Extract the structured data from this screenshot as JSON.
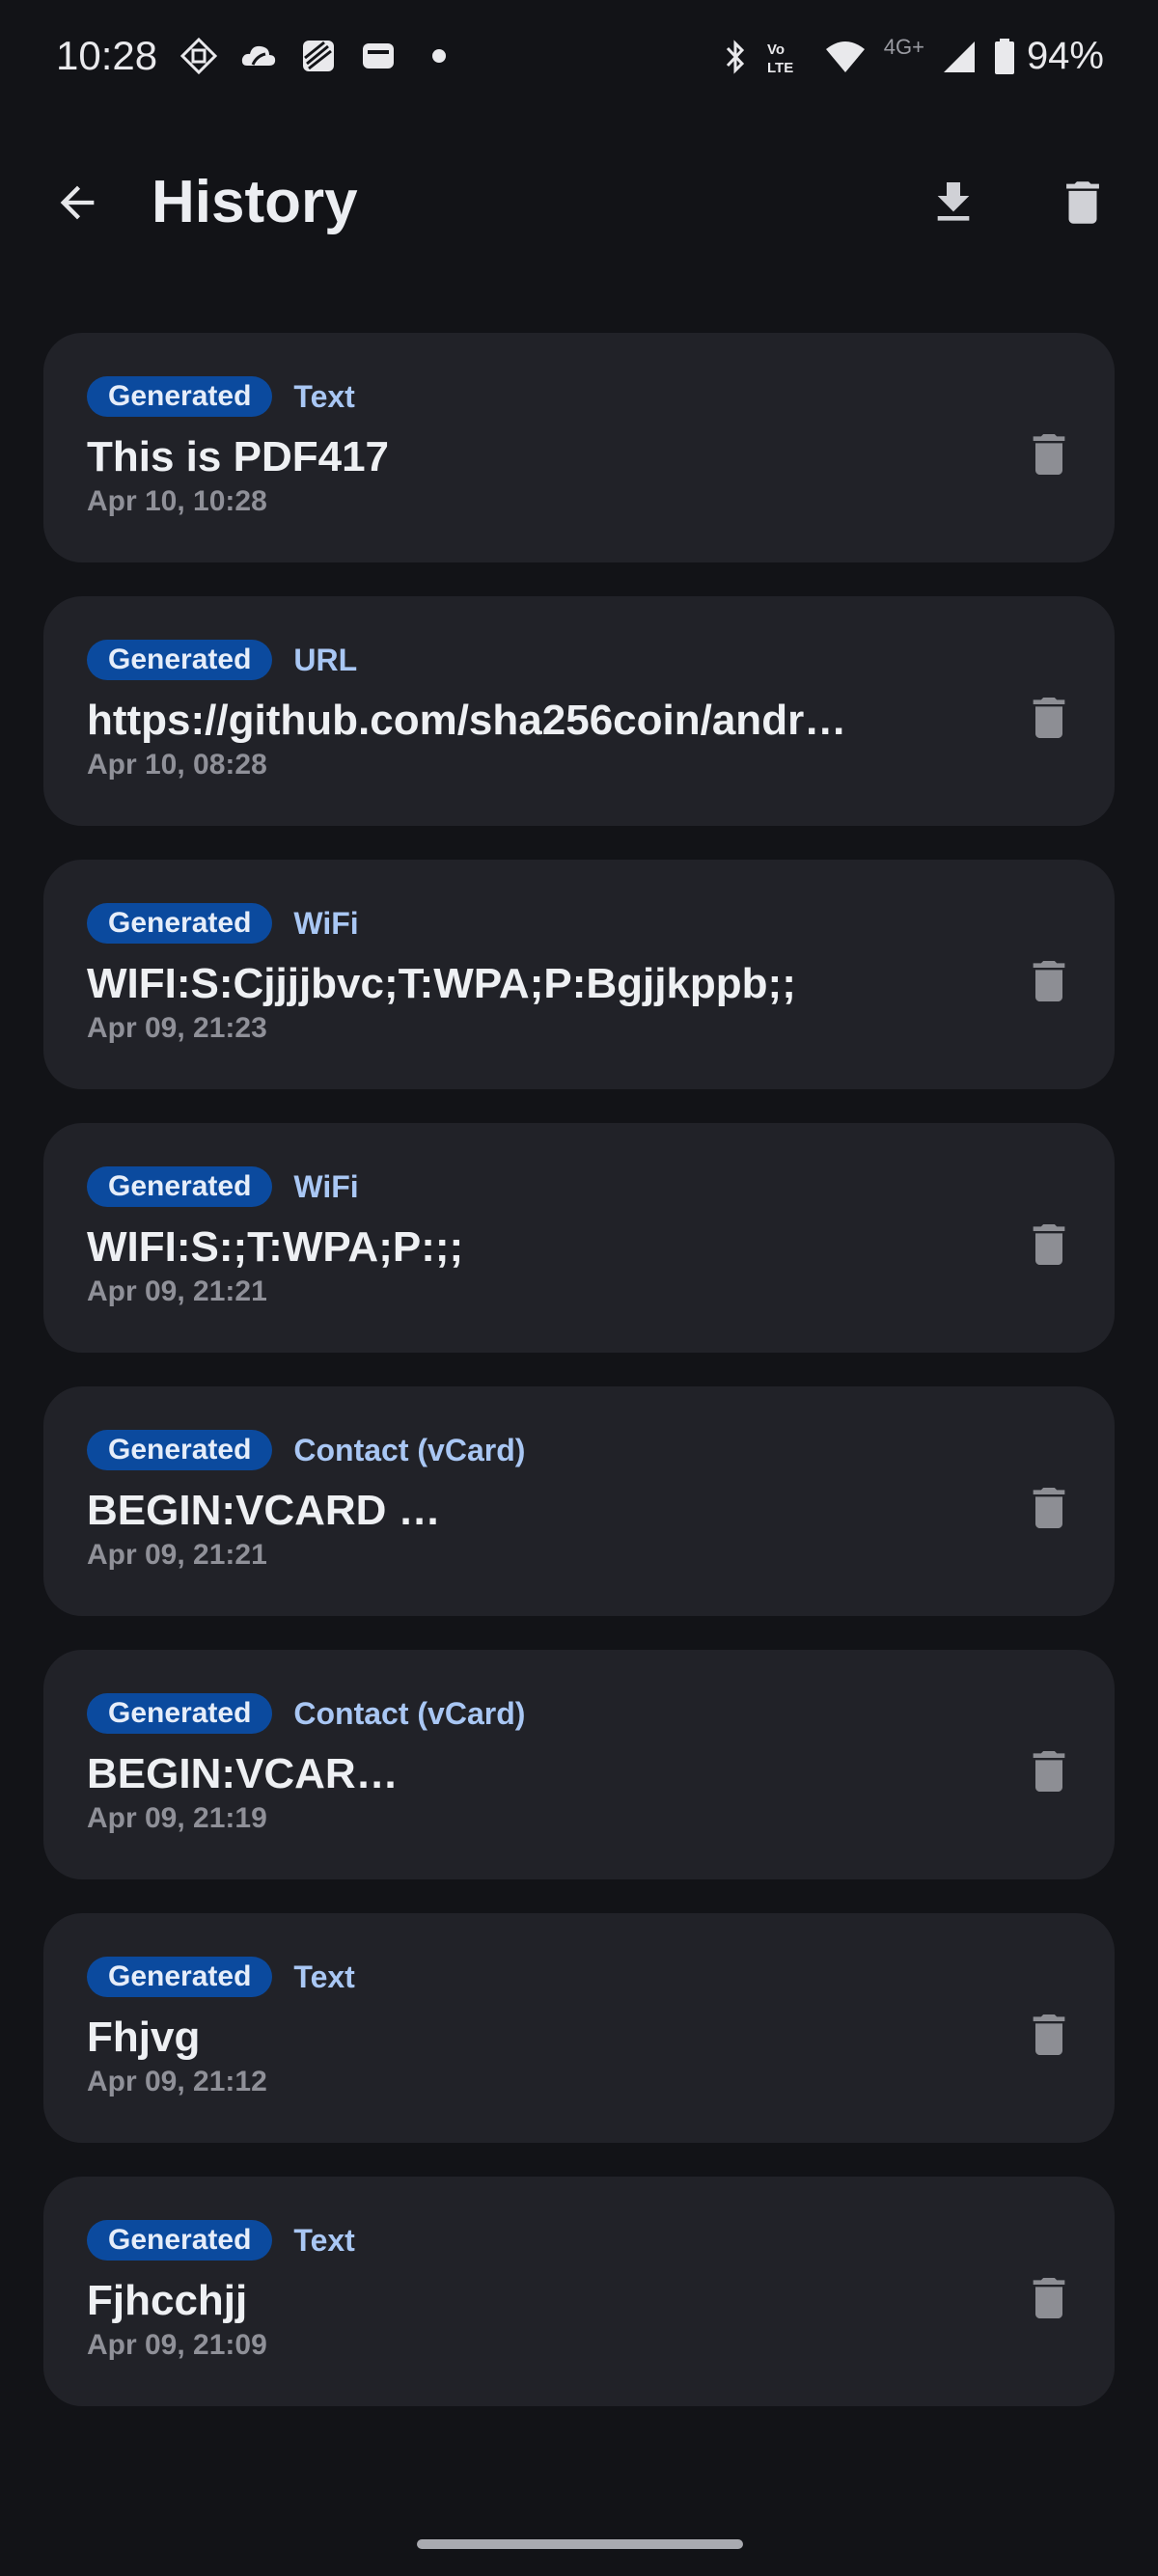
{
  "status_bar": {
    "time": "10:28",
    "network_label": "4G+",
    "battery": "94%"
  },
  "header": {
    "title": "History",
    "back_icon": "arrow-left-icon",
    "download_icon": "download-icon",
    "delete_all_icon": "trash-icon"
  },
  "items": [
    {
      "badge": "Generated",
      "type": "Text",
      "content": "This is PDF417",
      "time": "Apr 10, 10:28"
    },
    {
      "badge": "Generated",
      "type": "URL",
      "content": "https://github.com/sha256coin/andr…",
      "time": "Apr 10, 08:28"
    },
    {
      "badge": "Generated",
      "type": "WiFi",
      "content": "WIFI:S:Cjjjjbvc;T:WPA;P:Bgjjkppb;;",
      "time": "Apr 09, 21:23"
    },
    {
      "badge": "Generated",
      "type": "WiFi",
      "content": "WIFI:S:;T:WPA;P:;;",
      "time": "Apr 09, 21:21"
    },
    {
      "badge": "Generated",
      "type": "Contact (vCard)",
      "content": "BEGIN:VCARD …",
      "time": "Apr 09, 21:21"
    },
    {
      "badge": "Generated",
      "type": "Contact (vCard)",
      "content": "BEGIN:VCAR…",
      "time": "Apr 09, 21:19"
    },
    {
      "badge": "Generated",
      "type": "Text",
      "content": "Fhjvg",
      "time": "Apr 09, 21:12"
    },
    {
      "badge": "Generated",
      "type": "Text",
      "content": "Fjhcchjj",
      "time": "Apr 09, 21:09"
    }
  ],
  "colors": {
    "background": "#121317",
    "card": "#212228",
    "chip": "#0b4a9e",
    "type_text": "#a9c7f4"
  }
}
